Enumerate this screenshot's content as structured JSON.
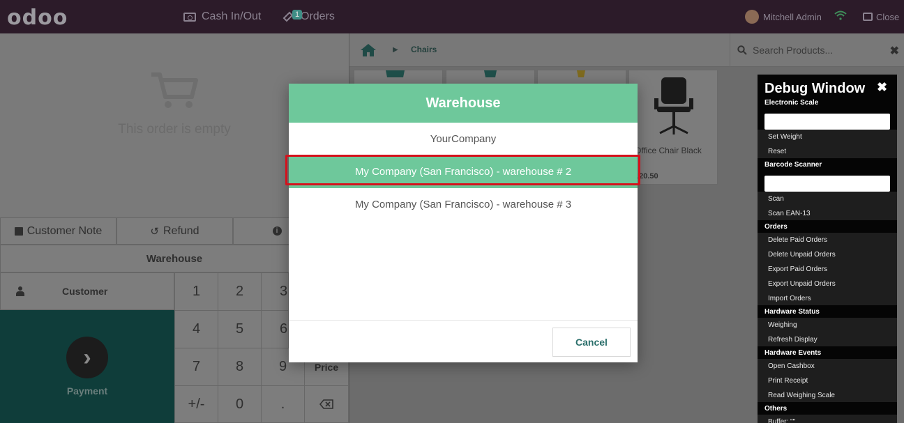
{
  "topbar": {
    "logo": "odoo",
    "cash_label": "Cash In/Out",
    "orders_label": "Orders",
    "orders_badge": "1",
    "user_name": "Mitchell Admin",
    "close_label": "Close"
  },
  "order": {
    "empty_text": "This order is empty",
    "customer_note_label": "Customer Note",
    "refund_label": "Refund",
    "warehouse_label": "Warehouse",
    "customer_label": "Customer",
    "payment_label": "Payment"
  },
  "numpad": {
    "keys": [
      "1",
      "2",
      "3",
      "4",
      "5",
      "6",
      "7",
      "8",
      "9",
      "Price",
      "+/-",
      "0",
      "."
    ]
  },
  "products": {
    "breadcrumb": "Chairs",
    "search_placeholder": "Search Products...",
    "items": [
      {
        "name": "",
        "price": ""
      },
      {
        "name": "",
        "price": ""
      },
      {
        "name": "",
        "price": ""
      },
      {
        "name": "Office Chair Black",
        "price": "120.50"
      }
    ]
  },
  "debug": {
    "title": "Debug Window",
    "sections": {
      "scale": "Electronic Scale",
      "barcode": "Barcode Scanner",
      "orders": "Orders",
      "hardware_status": "Hardware Status",
      "hardware_events": "Hardware Events",
      "others": "Others"
    },
    "items": {
      "set_weight": "Set Weight",
      "reset": "Reset",
      "scan": "Scan",
      "scan_ean": "Scan EAN-13",
      "delete_paid": "Delete Paid Orders",
      "delete_unpaid": "Delete Unpaid Orders",
      "export_paid": "Export Paid Orders",
      "export_unpaid": "Export Unpaid Orders",
      "import": "Import Orders",
      "weighing": "Weighing",
      "refresh": "Refresh Display",
      "open_cashbox": "Open Cashbox",
      "print_receipt": "Print Receipt",
      "read_scale": "Read Weighing Scale",
      "buffer": "Buffer: \"\""
    }
  },
  "modal": {
    "title": "Warehouse",
    "options": [
      "YourCompany",
      "My Company (San Francisco) - warehouse # 2",
      "My Company (San Francisco) - warehouse # 3"
    ],
    "selected_index": 1,
    "cancel_label": "Cancel"
  },
  "colors": {
    "accent": "#6ec89b",
    "topbar": "#2c1b29",
    "highlight": "#d5121c"
  }
}
